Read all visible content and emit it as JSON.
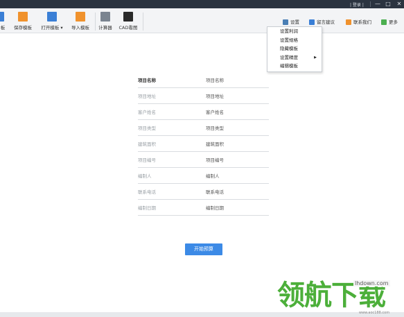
{
  "titlebar": {
    "text": "| 登录 |",
    "min": "—",
    "max": "□",
    "close": "✕"
  },
  "toolbar": {
    "tools": [
      {
        "label": "板",
        "icon": "template-icon",
        "color": "#3a7fd6"
      },
      {
        "label": "保存模板",
        "icon": "save-template-icon",
        "color": "#f0922d"
      },
      {
        "label": "打开模板 ▾",
        "icon": "open-template-icon",
        "color": "#3a7fd6"
      },
      {
        "label": "导入模板",
        "icon": "import-template-icon",
        "color": "#f0922d"
      },
      {
        "label": "计算器",
        "icon": "calculator-icon",
        "color": "#7a8490"
      },
      {
        "label": "CAD看图",
        "icon": "cad-viewer-icon",
        "color": "#2a2a2a"
      }
    ],
    "right": [
      {
        "label": "设置",
        "icon": "gear-icon",
        "color": "#4a7fb5"
      },
      {
        "label": "留言建议",
        "icon": "message-icon",
        "color": "#3a7fd6"
      },
      {
        "label": "联系我们",
        "icon": "contact-icon",
        "color": "#f0922d"
      },
      {
        "label": "更多",
        "icon": "more-icon",
        "color": "#4caf50"
      }
    ]
  },
  "menu": {
    "items": [
      {
        "label": "设置利润"
      },
      {
        "label": "设置规格"
      },
      {
        "label": "隐藏模板"
      },
      {
        "label": "设置精度",
        "arrow": "▶"
      },
      {
        "label": "编辑模板"
      }
    ]
  },
  "form": {
    "rows": [
      {
        "label": "项目名称",
        "value": "项目名称",
        "strong": true
      },
      {
        "label": "项目地址",
        "value": "项目地址",
        "strong": false
      },
      {
        "label": "客户姓名",
        "value": "客户姓名",
        "strong": false
      },
      {
        "label": "项目类型",
        "value": "项目类型",
        "strong": false
      },
      {
        "label": "建筑面积",
        "value": "建筑面积",
        "strong": false
      },
      {
        "label": "项目编号",
        "value": "项目编号",
        "strong": false
      },
      {
        "label": "编制人",
        "value": "编制人",
        "strong": false
      },
      {
        "label": "联系电话",
        "value": "联系电话",
        "strong": false
      },
      {
        "label": "编制日期",
        "value": "编制日期",
        "strong": false
      }
    ],
    "start_button": "开始预算"
  },
  "watermark": {
    "logo_text": "领航下载",
    "url": "lhdown.com",
    "sub": "www.aoc188.com"
  }
}
